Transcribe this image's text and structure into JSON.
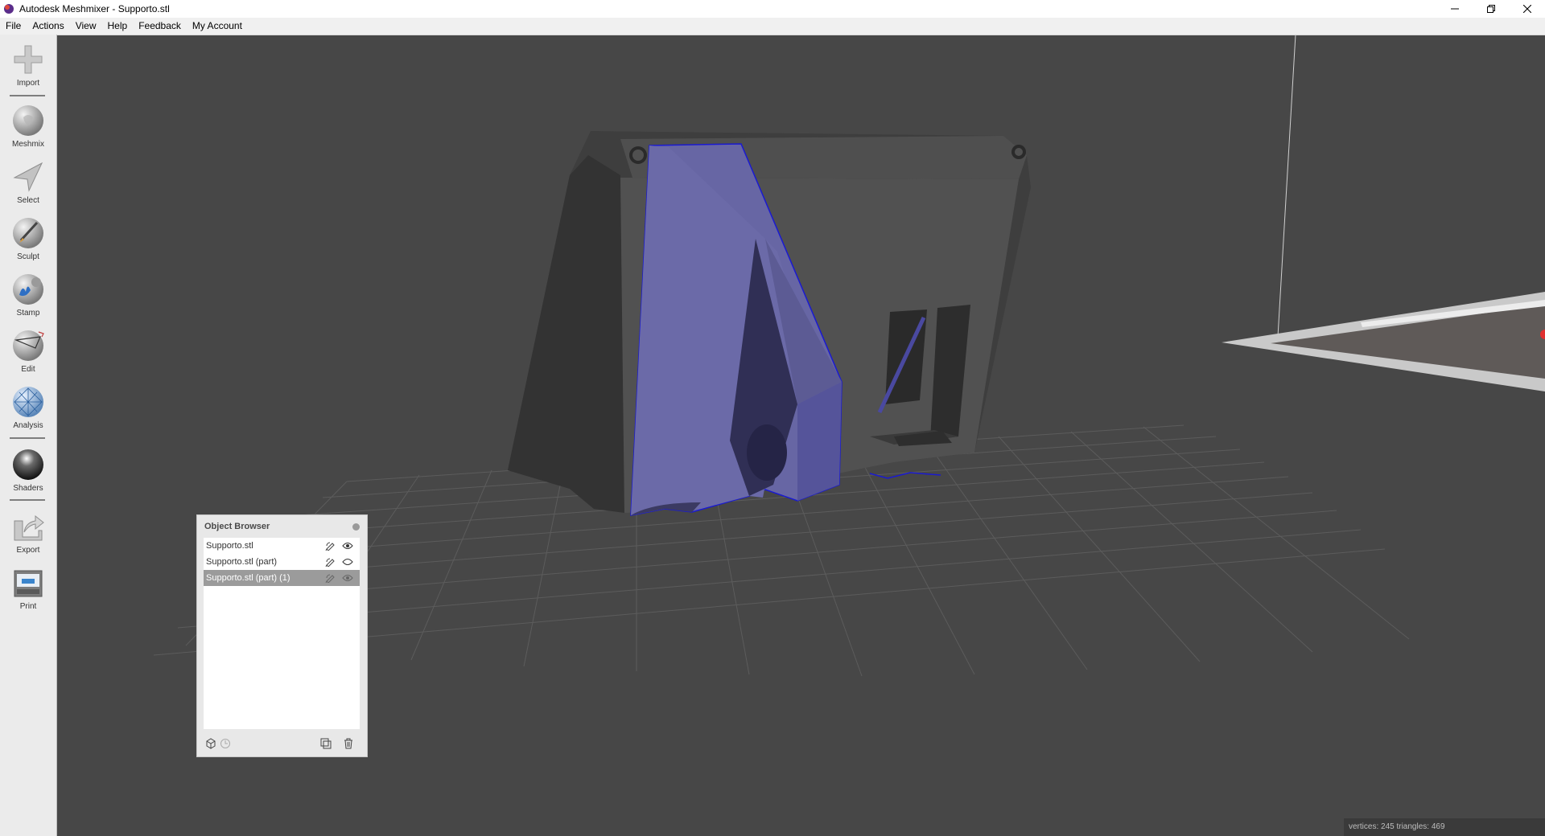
{
  "window": {
    "title": "Autodesk Meshmixer - Supporto.stl",
    "minimize_icon": "minimize-icon",
    "maximize_icon": "restore-icon",
    "close_icon": "close-icon"
  },
  "menu": [
    "File",
    "Actions",
    "View",
    "Help",
    "Feedback",
    "My Account"
  ],
  "tools": [
    {
      "label": "Import",
      "icon": "plus-icon"
    },
    {
      "label": "Meshmix",
      "icon": "bunny-sphere-icon"
    },
    {
      "label": "Select",
      "icon": "arrow-cursor-icon"
    },
    {
      "label": "Sculpt",
      "icon": "brush-sphere-icon"
    },
    {
      "label": "Stamp",
      "icon": "stamp-icon"
    },
    {
      "label": "Edit",
      "icon": "edit-sphere-icon"
    },
    {
      "label": "Analysis",
      "icon": "analysis-sphere-icon"
    },
    {
      "label": "Shaders",
      "icon": "shader-ball-icon"
    },
    {
      "label": "Export",
      "icon": "export-icon"
    },
    {
      "label": "Print",
      "icon": "print-icon"
    }
  ],
  "object_browser": {
    "title": "Object Browser",
    "items": [
      {
        "name": "Supporto.stl",
        "selected": false
      },
      {
        "name": "Supporto.stl (part)",
        "selected": false
      },
      {
        "name": "Supporto.stl (part) (1)",
        "selected": true
      }
    ]
  },
  "status": "vertices: 245 triangles: 469",
  "colors": {
    "viewport_bg": "#474747",
    "model": "#5a5a5a",
    "selection": "#6b6aa8",
    "selection_edge": "#1a1ad0"
  }
}
